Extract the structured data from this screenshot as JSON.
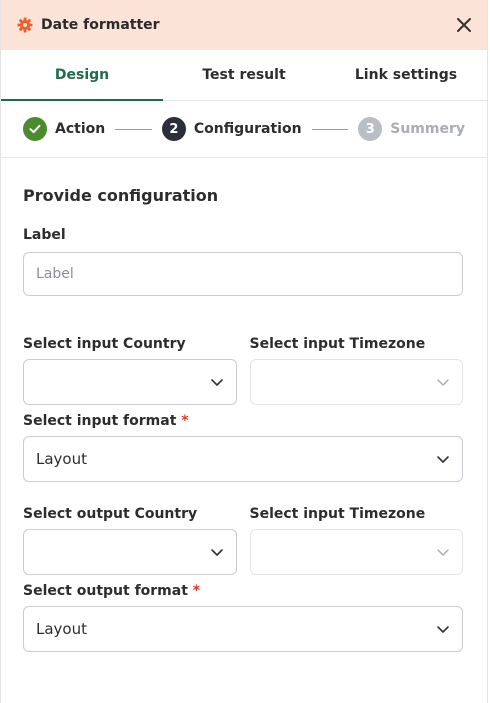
{
  "header": {
    "title": "Date formatter",
    "icon": "gear-icon",
    "accent": "#e8612c",
    "background": "#fbe3d7"
  },
  "tabs": [
    {
      "label": "Design",
      "active": true
    },
    {
      "label": "Test result",
      "active": false
    },
    {
      "label": "Link settings",
      "active": false
    }
  ],
  "stepper": {
    "steps": [
      {
        "label": "Action",
        "state": "done",
        "number": ""
      },
      {
        "label": "Configuration",
        "state": "current",
        "number": "2"
      },
      {
        "label": "Summery",
        "state": "pending",
        "number": "3"
      }
    ]
  },
  "form": {
    "section_title": "Provide configuration",
    "label_field": {
      "label": "Label",
      "placeholder": "Label",
      "value": ""
    },
    "input_country": {
      "label": "Select input Country",
      "value": ""
    },
    "input_timezone": {
      "label": "Select input Timezone",
      "value": ""
    },
    "input_format": {
      "label": "Select input format",
      "required_mark": "*",
      "value": "Layout"
    },
    "output_country": {
      "label": "Select output Country",
      "value": ""
    },
    "output_timezone": {
      "label": "Select input Timezone",
      "value": ""
    },
    "output_format": {
      "label": "Select output format",
      "required_mark": "*",
      "value": "Layout"
    }
  },
  "colors": {
    "accent_green": "#1f6b4a",
    "done_green": "#4c8a2e",
    "required_red": "#d93a2a"
  }
}
